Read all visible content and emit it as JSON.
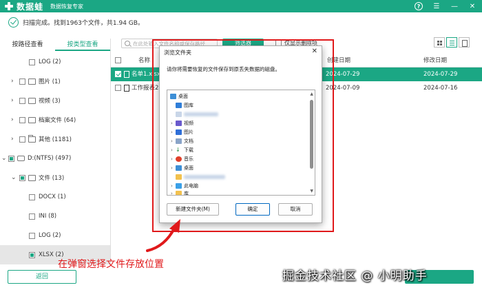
{
  "app": {
    "name": "数据蛙",
    "subtitle": "数据恢复专家"
  },
  "status": {
    "text": "扫描完成。找到1963个文件，共1.94 GB。"
  },
  "left_tabs": [
    {
      "label": "按路径查看",
      "active": false
    },
    {
      "label": "按类型查看",
      "active": true
    }
  ],
  "tree": [
    {
      "label": "LOG (2)"
    },
    {
      "label": "图片 (1)"
    },
    {
      "label": "视频 (3)"
    },
    {
      "label": "档案文件 (64)"
    },
    {
      "label": "其他 (1181)"
    },
    {
      "label": "D:(NTFS) (497)"
    },
    {
      "label": "文件 (13)"
    },
    {
      "label": "DOCX (1)"
    },
    {
      "label": "INI (8)"
    },
    {
      "label": "LOG (2)"
    },
    {
      "label": "XLSX (2)"
    }
  ],
  "toolbar": {
    "search_placeholder": "在此处输入文件名称或保存路径",
    "filter_label": "筛选器",
    "only_deleted_label": "仅显示删除项"
  },
  "table": {
    "headers": [
      "名称",
      "创建日期",
      "修改日期"
    ],
    "rows": [
      {
        "name": "名单1.xlsx",
        "created": "2024-07-29",
        "modified": "2024-07-29",
        "selected": true
      },
      {
        "name": "工作报表2",
        "created": "2024-07-09",
        "modified": "2024-07-16",
        "selected": false
      }
    ]
  },
  "dialog": {
    "title": "浏览文件夹",
    "close": "✕",
    "message": "请你将需要恢复的文件保存到原丢失数据的磁盘。",
    "tree": [
      {
        "label": "桌面"
      },
      {
        "label": "图库"
      },
      {
        "label": ""
      },
      {
        "label": "视频"
      },
      {
        "label": "图片"
      },
      {
        "label": "文档"
      },
      {
        "label": "下载"
      },
      {
        "label": "音乐"
      },
      {
        "label": "桌面"
      },
      {
        "label": ""
      },
      {
        "label": "此电脑"
      },
      {
        "label": "库"
      }
    ],
    "buttons": {
      "new_folder": "新建文件夹(M)",
      "ok": "确定",
      "cancel": "取消"
    }
  },
  "footer": {
    "back_label": "返回"
  },
  "annotation": {
    "caption": "在弹窗选择文件存放位置"
  },
  "watermark": "掘金技术社区 @ 小明助手",
  "colors": {
    "brand": "#1ba784",
    "annotation": "#e0191b"
  }
}
